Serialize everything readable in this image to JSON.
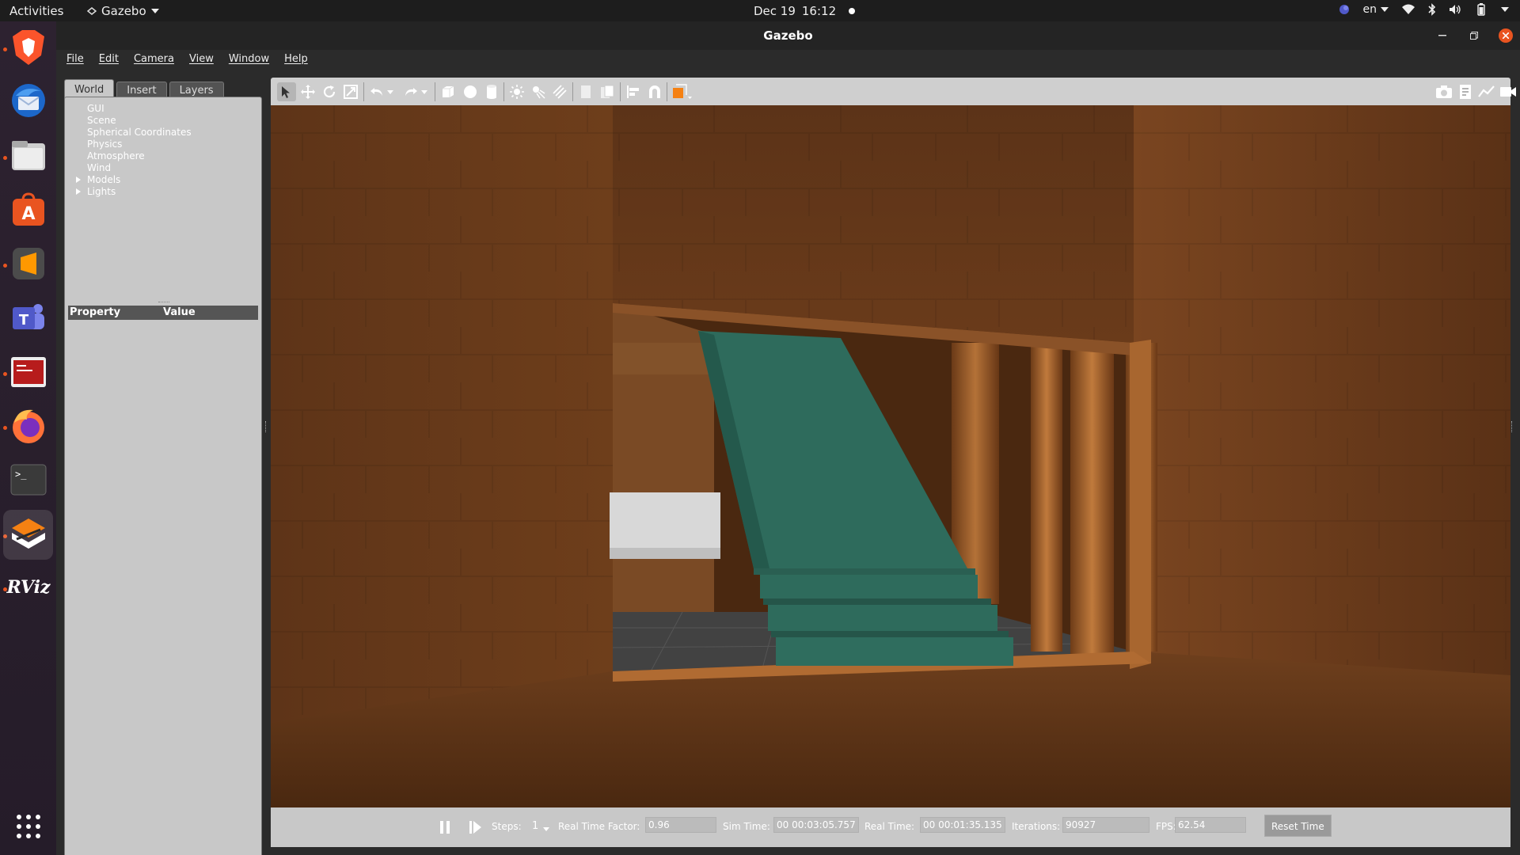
{
  "topbar": {
    "activities": "Activities",
    "app_name": "Gazebo",
    "date": "Dec 19",
    "time": "16:12",
    "language": "en"
  },
  "window": {
    "title": "Gazebo"
  },
  "menu": [
    "File",
    "Edit",
    "Camera",
    "View",
    "Window",
    "Help"
  ],
  "left_panel": {
    "tabs": [
      "World",
      "Insert",
      "Layers"
    ],
    "active_tab": "World",
    "tree": [
      {
        "label": "GUI",
        "expandable": false
      },
      {
        "label": "Scene",
        "expandable": false
      },
      {
        "label": "Spherical Coordinates",
        "expandable": false
      },
      {
        "label": "Physics",
        "expandable": false
      },
      {
        "label": "Atmosphere",
        "expandable": false
      },
      {
        "label": "Wind",
        "expandable": false
      },
      {
        "label": "Models",
        "expandable": true
      },
      {
        "label": "Lights",
        "expandable": true
      }
    ],
    "property_header": {
      "property": "Property",
      "value": "Value"
    }
  },
  "statusbar": {
    "steps_label": "Steps:",
    "steps_value": "1",
    "rtf_label": "Real Time Factor:",
    "rtf_value": "0.96",
    "sim_time_label": "Sim Time:",
    "sim_time_value": "00 00:03:05.757",
    "real_time_label": "Real Time:",
    "real_time_value": "00 00:01:35.135",
    "iterations_label": "Iterations:",
    "iterations_value": "90927",
    "fps_label": "FPS:",
    "fps_value": "62.54",
    "reset_button": "Reset Time"
  },
  "dock_apps": [
    "brave-browser",
    "thunderbird",
    "files",
    "app-center",
    "sublime-text",
    "teams",
    "terminal-app",
    "firefox",
    "terminal",
    "gazebo",
    "rviz"
  ],
  "rviz_label": "RViz",
  "colors": {
    "accent": "#e95420",
    "stairs": "#2e6b5c",
    "wood": "#6b3a1a"
  }
}
